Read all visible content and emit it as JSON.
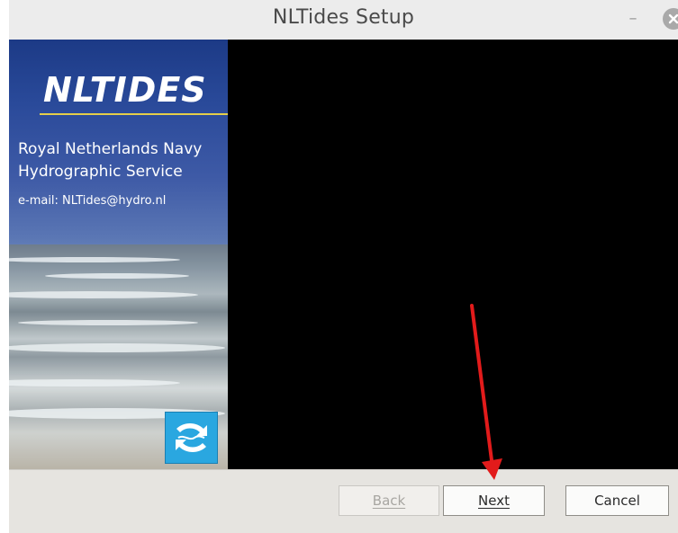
{
  "window": {
    "title": "NLTides Setup",
    "minimize_glyph": "–",
    "close_icon": "close-icon"
  },
  "sidebar": {
    "logo_text": "NLTIDES",
    "org_line1": "Royal Netherlands Navy",
    "org_line2": "Hydrographic Service",
    "email": "e-mail: NLTides@hydro.nl",
    "badge_icon": "waves-icon"
  },
  "footer": {
    "back_label": "Back",
    "next_label": "Next",
    "cancel_label": "Cancel"
  },
  "annotation": {
    "arrow_color": "#e21b1b"
  },
  "colors": {
    "content_bg": "#000000",
    "accent_yellow": "#e4cf4a",
    "badge_blue": "#2aa7e0"
  }
}
